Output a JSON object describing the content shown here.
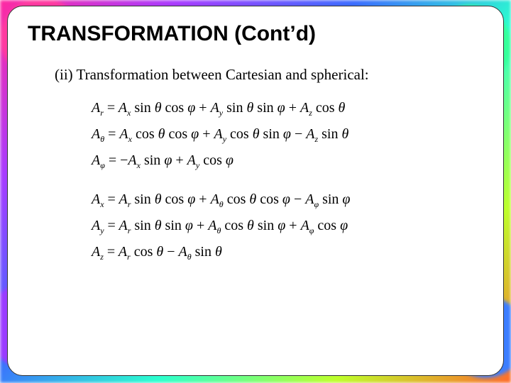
{
  "title": "TRANSFORMATION (Cont’d)",
  "item_heading": "(ii) Transformation between Cartesian and spherical:",
  "fn": {
    "sin": "sin",
    "cos": "cos"
  },
  "equations": {
    "to_spherical": [
      "A_r = A_x sinθ cosφ + A_y sinθ sinφ + A_z cosθ",
      "A_θ = A_x cosθ cosφ + A_y cosθ sinφ − A_z sinθ",
      "A_φ = −A_x sinφ + A_y cosφ"
    ],
    "to_cartesian": [
      "A_x = A_r sinθ cosφ + A_θ cosθ cosφ − A_φ sinφ",
      "A_y = A_r sinθ sinφ + A_θ cosθ sinφ + A_φ cosφ",
      "A_z = A_r cosθ − A_θ sinθ"
    ]
  }
}
